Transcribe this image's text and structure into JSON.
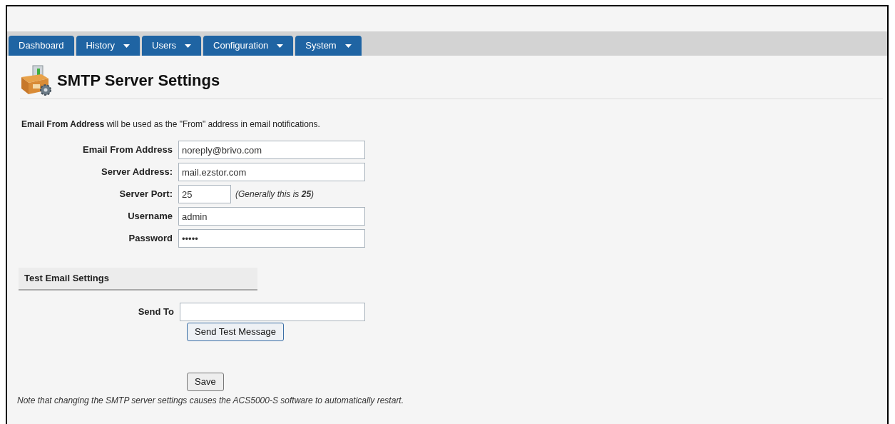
{
  "nav": {
    "tabs": [
      {
        "label": "Dashboard",
        "has_menu": false
      },
      {
        "label": "History",
        "has_menu": true
      },
      {
        "label": "Users",
        "has_menu": true
      },
      {
        "label": "Configuration",
        "has_menu": true
      },
      {
        "label": "System",
        "has_menu": true
      }
    ]
  },
  "page": {
    "title": "SMTP Server Settings",
    "intro": "**Email From Address** will be used as the \"From\" address in email notifications."
  },
  "fields": [
    {
      "label": "Email From Address",
      "value": "noreply@brivo.com",
      "kind": "wide"
    },
    {
      "label": "Server Address:",
      "value": "mail.ezstor.com",
      "kind": "wide"
    },
    {
      "label": "Server Port:",
      "value": "25",
      "kind": "narrow",
      "hint": "(Generally this is **25**)"
    },
    {
      "label": "Username",
      "value": "admin",
      "kind": "wide"
    },
    {
      "label": "Password",
      "value": "•••••",
      "kind": "wide"
    }
  ],
  "test_section": {
    "title": "Test Email Settings",
    "field": {
      "label": "Send To"
    },
    "button": "Send Test Message"
  },
  "save_button": "Save",
  "note": "Note that changing the SMTP server settings causes the ACS5000-S software to automatically restart."
}
